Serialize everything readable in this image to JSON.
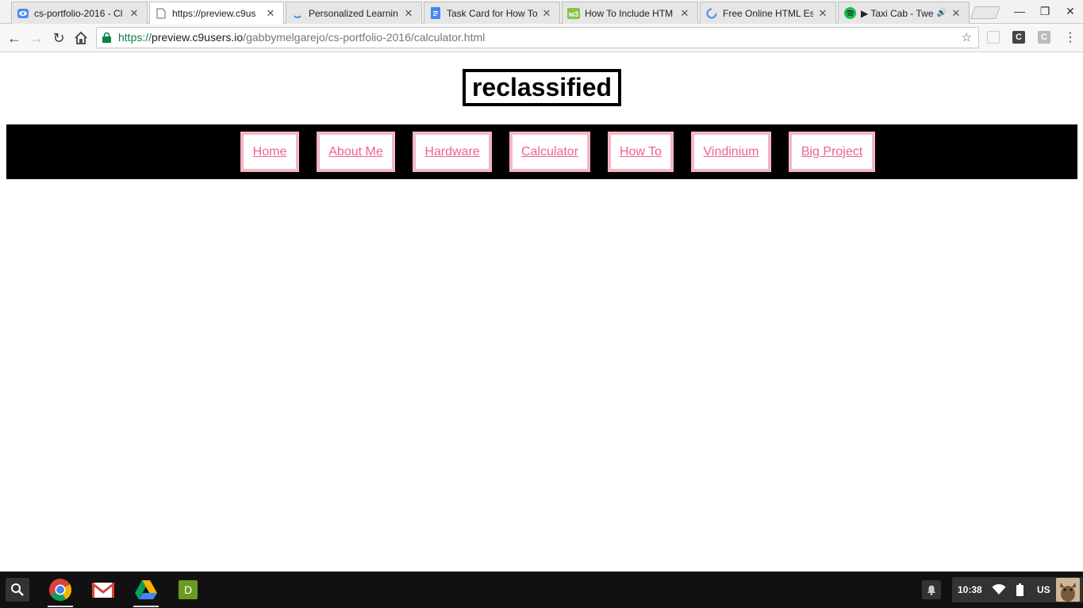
{
  "tabs": [
    {
      "title": "cs-portfolio-2016 - Cl",
      "icon": "cloud9-eye-icon",
      "active": false
    },
    {
      "title": "https://preview.c9us",
      "icon": "page-icon",
      "active": true
    },
    {
      "title": "Personalized Learnin",
      "icon": "loading-icon",
      "active": false
    },
    {
      "title": "Task Card for How To",
      "icon": "google-docs-icon",
      "active": false
    },
    {
      "title": "How To Include HTM",
      "icon": "w3-icon",
      "active": false
    },
    {
      "title": "Free Online HTML Es",
      "icon": "loading-icon",
      "active": false
    },
    {
      "title": "▶ Taxi Cab - Twe",
      "icon": "spotify-icon",
      "active": false
    }
  ],
  "window_controls": {
    "minimize": "—",
    "restore": "❐",
    "close": "✕"
  },
  "address_bar": {
    "scheme": "https://",
    "host": "preview.c9users.io",
    "path": "/gabbymelgarejo/cs-portfolio-2016/calculator.html"
  },
  "extensions": [
    "C",
    "C"
  ],
  "page": {
    "title": "reclassified",
    "nav": [
      "Home",
      "About Me",
      "Hardware",
      "Calculator",
      "How To",
      "Vindinium",
      "Big Project"
    ]
  },
  "colors": {
    "nav_background": "#000000",
    "nav_border": "#f4b6c2",
    "nav_link": "#f06292"
  },
  "shelf": {
    "apps": [
      "search-icon",
      "chrome-icon",
      "gmail-icon",
      "drive-icon",
      "d-app-icon"
    ],
    "d_app_label": "D",
    "clock": "10:38",
    "locale": "US"
  }
}
